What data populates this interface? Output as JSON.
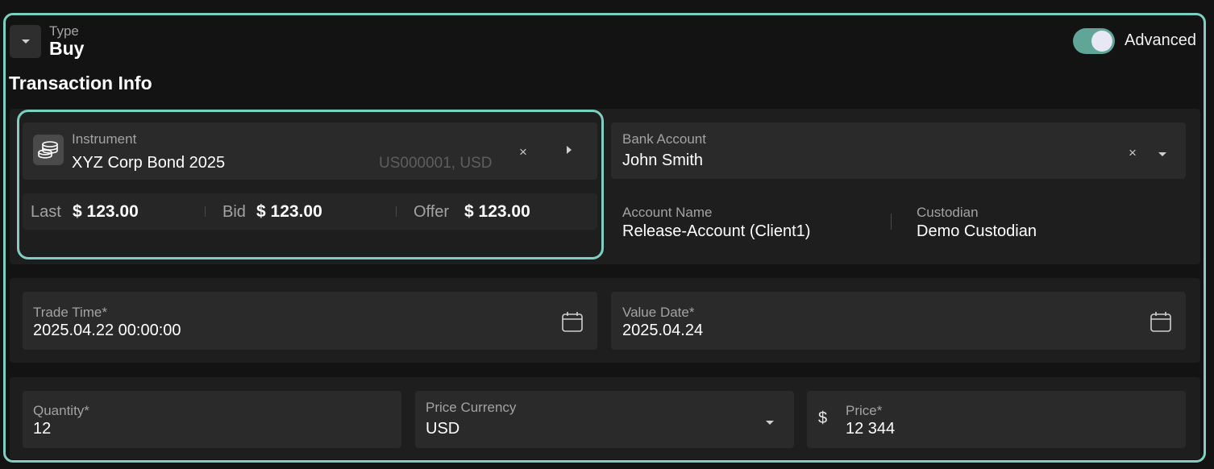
{
  "header": {
    "type_label": "Type",
    "type_value": "Buy",
    "advanced_label": "Advanced",
    "advanced_on": true
  },
  "section_title": "Transaction Info",
  "instrument": {
    "label": "Instrument",
    "value": "XYZ Corp Bond 2025",
    "code": "US000001, USD",
    "clear_symbol": "×",
    "icon": "coins-icon"
  },
  "prices": {
    "last_label": "Last",
    "last_value": "$ 123.00",
    "bid_label": "Bid",
    "bid_value": "$ 123.00",
    "offer_label": "Offer",
    "offer_value": "$ 123.00"
  },
  "bank_account": {
    "label": "Bank Account",
    "value": "John Smith",
    "clear_symbol": "×"
  },
  "account_name": {
    "label": "Account Name",
    "value": "Release-Account (Client1)"
  },
  "custodian": {
    "label": "Custodian",
    "value": "Demo Custodian"
  },
  "trade_time": {
    "label": "Trade Time*",
    "value": "2025.04.22 00:00:00"
  },
  "value_date": {
    "label": "Value Date*",
    "value": "2025.04.24"
  },
  "quantity": {
    "label": "Quantity*",
    "value": "12"
  },
  "price_currency": {
    "label": "Price Currency",
    "value": "USD"
  },
  "price": {
    "label": "Price*",
    "value": "12 344",
    "symbol": "$"
  },
  "colors": {
    "accent": "#7ecfc0",
    "toggle_on": "#5fa697",
    "background": "#131313",
    "panel": "#1e1e1e",
    "field": "#2a2a2a"
  }
}
